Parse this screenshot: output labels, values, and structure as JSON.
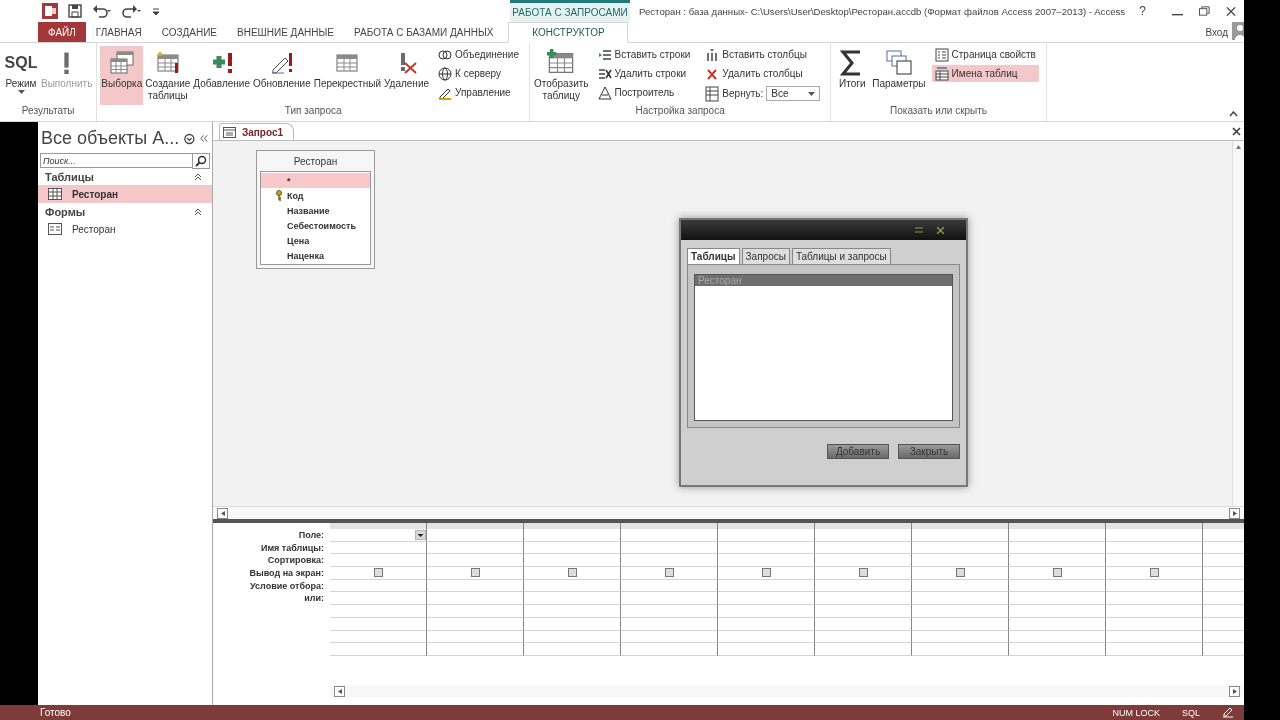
{
  "title_bar": {
    "context_label": "РАБОТА С ЗАПРОСАМИ",
    "title": "Ресторан : база данных- C:\\Users\\User\\Desktop\\Ресторан.accdb (Формат файлов Access 2007–2013) - Access",
    "help": "?"
  },
  "tabs": [
    {
      "label": "ФАЙЛ",
      "kind": "file",
      "selected": false
    },
    {
      "label": "ГЛАВНАЯ",
      "kind": "tab",
      "selected": false
    },
    {
      "label": "СОЗДАНИЕ",
      "kind": "tab",
      "selected": false
    },
    {
      "label": "ВНЕШНИЕ ДАННЫЕ",
      "kind": "tab",
      "selected": false
    },
    {
      "label": "РАБОТА С БАЗАМИ ДАННЫХ",
      "kind": "tab",
      "selected": false
    },
    {
      "label": "КОНСТРУКТОР",
      "kind": "tab",
      "selected": true
    }
  ],
  "account": "Вход",
  "ribbon": {
    "groups": [
      {
        "label": "Результаты",
        "items": [
          {
            "kind": "menu-large",
            "icon_text": "SQL",
            "label": "Режим",
            "selected": false,
            "disabled": false
          },
          {
            "kind": "large",
            "label": "Выполнить",
            "selected": false,
            "disabled": true
          }
        ]
      },
      {
        "label": "Тип запроса",
        "items": [
          {
            "kind": "large",
            "label": "Выборка",
            "selected": true,
            "disabled": false
          },
          {
            "kind": "large",
            "label": "Создание\nтаблицы",
            "selected": false,
            "disabled": false
          },
          {
            "kind": "large",
            "label": "Добавление",
            "selected": false,
            "disabled": false
          },
          {
            "kind": "large",
            "label": "Обновление",
            "selected": false,
            "disabled": false
          },
          {
            "kind": "large",
            "label": "Перекрестный",
            "selected": false,
            "disabled": false
          },
          {
            "kind": "large",
            "label": "Удаление",
            "selected": false,
            "disabled": false
          },
          {
            "kind": "column",
            "items": [
              {
                "kind": "small",
                "label": "Объединение",
                "selected": false
              },
              {
                "kind": "small",
                "label": "К серверу",
                "selected": false
              },
              {
                "kind": "small",
                "label": "Управление",
                "selected": false
              }
            ]
          }
        ]
      },
      {
        "label": "Настройка запроса",
        "items": [
          {
            "kind": "large",
            "label": "Отобразить\nтаблицу",
            "selected": false,
            "disabled": false
          },
          {
            "kind": "column",
            "items": [
              {
                "kind": "small",
                "label": "Вставить строки",
                "selected": false
              },
              {
                "kind": "small",
                "label": "Удалить строки",
                "selected": false
              },
              {
                "kind": "small",
                "label": "Построитель",
                "selected": false
              }
            ]
          },
          {
            "kind": "column",
            "items": [
              {
                "kind": "small",
                "label": "Вставить столбцы",
                "selected": false
              },
              {
                "kind": "small",
                "label": "Удалить столбцы",
                "selected": false
              },
              {
                "kind": "combo",
                "label": "Вернуть:",
                "value": "Все",
                "selected": false
              }
            ]
          }
        ]
      },
      {
        "label": "Показать или скрыть",
        "items": [
          {
            "kind": "large",
            "label": "Итоги",
            "selected": false,
            "disabled": false
          },
          {
            "kind": "large",
            "label": "Параметры",
            "selected": false,
            "disabled": false
          },
          {
            "kind": "column",
            "items": [
              {
                "kind": "small",
                "label": "Страница свойств",
                "selected": false
              },
              {
                "kind": "small",
                "label": "Имена таблиц",
                "selected": true
              }
            ]
          }
        ]
      }
    ]
  },
  "nav": {
    "title": "Все объекты A...",
    "search": {
      "placeholder": "Поиск..."
    },
    "groups": [
      {
        "label": "Таблицы",
        "expanded": true,
        "items": [
          {
            "label": "Ресторан",
            "kind": "table",
            "selected": true
          }
        ]
      },
      {
        "label": "Формы",
        "expanded": true,
        "items": [
          {
            "label": "Ресторан",
            "kind": "form",
            "selected": false
          }
        ]
      }
    ]
  },
  "doc_tabs": [
    {
      "label": "Запрос1",
      "selected": true
    }
  ],
  "table_box": {
    "title": "Ресторан",
    "fields": [
      {
        "name": "*",
        "key": false,
        "selected": true
      },
      {
        "name": "Код",
        "key": true,
        "selected": false
      },
      {
        "name": "Название",
        "key": false,
        "selected": false
      },
      {
        "name": "Себестоимость",
        "key": false,
        "selected": false
      },
      {
        "name": "Цена",
        "key": false,
        "selected": false
      },
      {
        "name": "Наценка",
        "key": false,
        "selected": false
      }
    ]
  },
  "dialog": {
    "tabs": [
      {
        "label": "Таблицы",
        "selected": true
      },
      {
        "label": "Запросы",
        "selected": false
      },
      {
        "label": "Таблицы и запросы",
        "selected": false
      }
    ],
    "list": [
      {
        "label": "Ресторан",
        "selected": true
      }
    ],
    "buttons": [
      "Добавить",
      "Закрыть"
    ]
  },
  "grid": {
    "rows": [
      {
        "label": "Поле:",
        "kind": "text"
      },
      {
        "label": "Имя таблицы:",
        "kind": "text"
      },
      {
        "label": "Сортировка:",
        "kind": "text"
      },
      {
        "label": "Вывод на экран:",
        "kind": "checkbox"
      },
      {
        "label": "Условие отбора:",
        "kind": "text"
      },
      {
        "label": "или:",
        "kind": "text"
      }
    ],
    "columns": [
      {
        "checked": false,
        "focused": true
      },
      {
        "checked": false,
        "focused": false
      },
      {
        "checked": false,
        "focused": false
      },
      {
        "checked": false,
        "focused": false
      },
      {
        "checked": false,
        "focused": false
      },
      {
        "checked": false,
        "focused": false
      },
      {
        "checked": false,
        "focused": false
      },
      {
        "checked": false,
        "focused": false
      },
      {
        "checked": false,
        "focused": false
      }
    ]
  },
  "status_bar": {
    "text": "Готово",
    "indicators": [
      "NUM LOCK",
      "SQL"
    ]
  }
}
